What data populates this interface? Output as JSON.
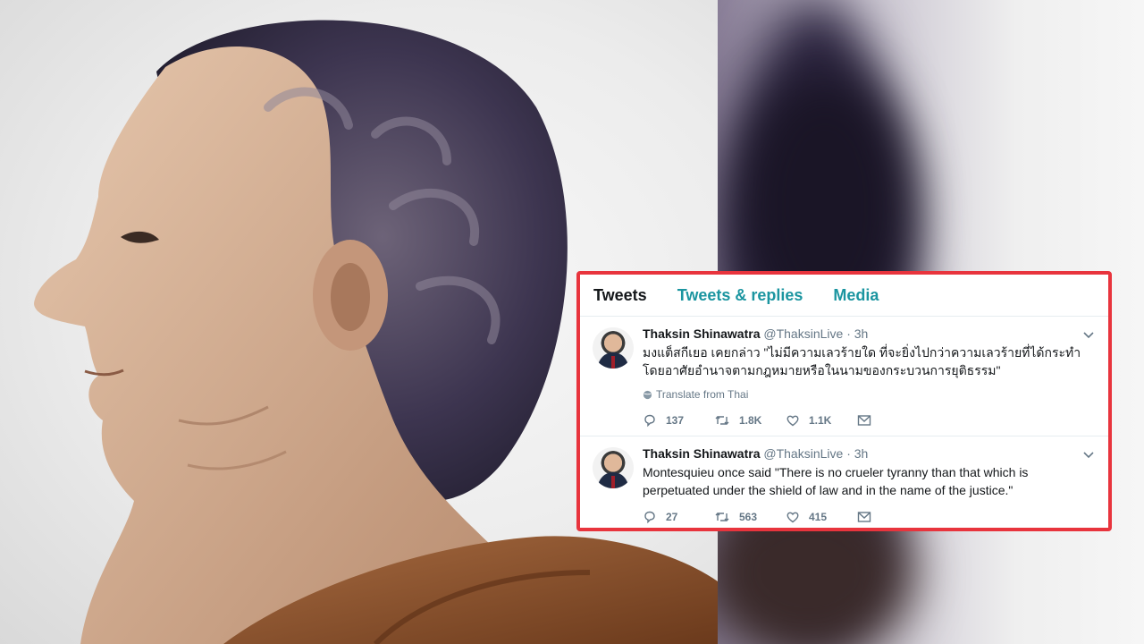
{
  "tabs": [
    {
      "label": "Tweets",
      "active": true
    },
    {
      "label": "Tweets & replies",
      "active": false
    },
    {
      "label": "Media",
      "active": false
    }
  ],
  "tweets": [
    {
      "name": "Thaksin Shinawatra",
      "handle": "@ThaksinLive",
      "separator": "·",
      "time": "3h",
      "text": "มงแต็สกีเยอ เคยกล่าว \"ไม่มีความเลวร้ายใด ที่จะยิ่งไปกว่าความเลวร้ายที่ได้กระทำโดยอาศัยอำนาจตามกฎหมายหรือในนามของกระบวนการยุติธรรม\"",
      "translate": "Translate from Thai",
      "replies": "137",
      "retweets": "1.8K",
      "likes": "1.1K"
    },
    {
      "name": "Thaksin Shinawatra",
      "handle": "@ThaksinLive",
      "separator": "·",
      "time": "3h",
      "text": "Montesquieu once said \"There is no crueler tyranny than that which is perpetuated under the shield of law and in the name of the justice.\"",
      "replies": "27",
      "retweets": "563",
      "likes": "415"
    }
  ],
  "colors": {
    "highlight": "#e8343d",
    "link": "#1b95a0",
    "muted": "#657786",
    "text": "#14171a"
  },
  "icons": [
    "reply-icon",
    "retweet-icon",
    "like-icon",
    "mail-icon",
    "caret-down-icon",
    "globe-icon"
  ]
}
